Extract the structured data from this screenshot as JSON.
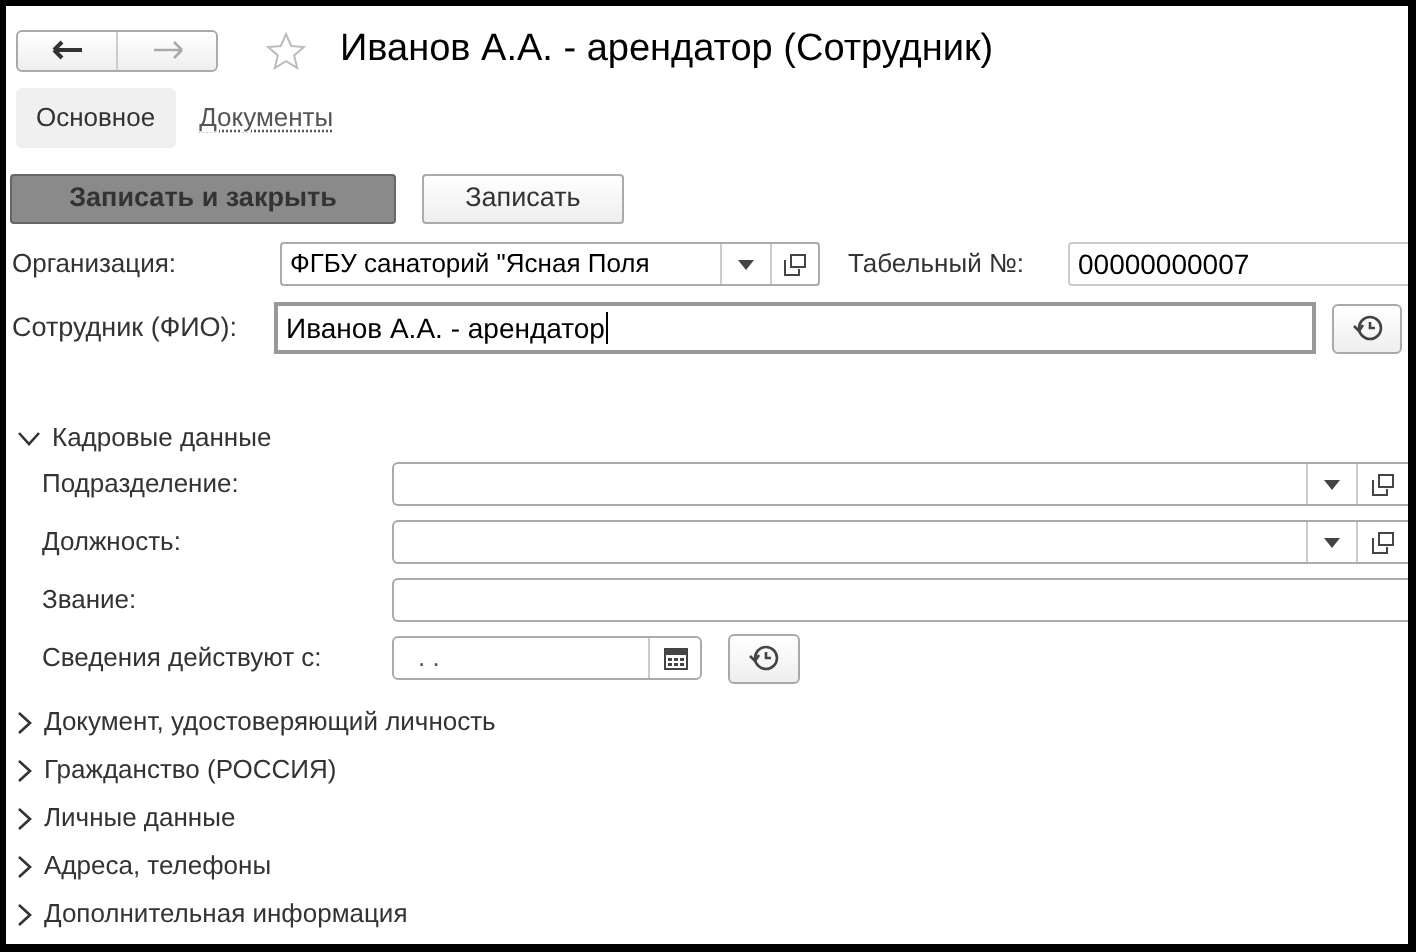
{
  "nav": [
    {
      "kind": "back",
      "disabled": false
    },
    {
      "kind": "forward",
      "disabled": true
    }
  ],
  "favorite": false,
  "title": "Иванов А.А. - арендатор (Сотрудник)",
  "tabs": [
    {
      "label": "Основное",
      "selected": true
    },
    {
      "label": "Документы",
      "selected": false
    }
  ],
  "buttons": [
    {
      "label": "Записать и закрыть",
      "kind": "default"
    },
    {
      "label": "Записать",
      "kind": "normal"
    }
  ],
  "organization": {
    "label": "Организация:",
    "value": "ФГБУ санаторий \"Ясная Поля"
  },
  "tab_number": {
    "label": "Табельный №:",
    "value": "00000000007"
  },
  "employee": {
    "label": "Сотрудник (ФИО):",
    "value": "Иванов А.А. - арендатор"
  },
  "sections": [
    {
      "title": "Кадровые данные",
      "expanded": true,
      "fields": [
        {
          "label": "Подразделение:",
          "kind": "select"
        },
        {
          "label": "Должность:",
          "kind": "select"
        },
        {
          "label": "Звание:",
          "kind": "text"
        },
        {
          "label": "Сведения действуют с:",
          "kind": "date",
          "value": ". ."
        }
      ]
    },
    {
      "title": "Документ, удостоверяющий личность",
      "expanded": false
    },
    {
      "title": "Гражданство (РОССИЯ)",
      "expanded": false
    },
    {
      "title": "Личные данные",
      "expanded": false
    },
    {
      "title": "Адреса, телефоны",
      "expanded": false
    },
    {
      "title": "Дополнительная информация",
      "expanded": false
    }
  ]
}
